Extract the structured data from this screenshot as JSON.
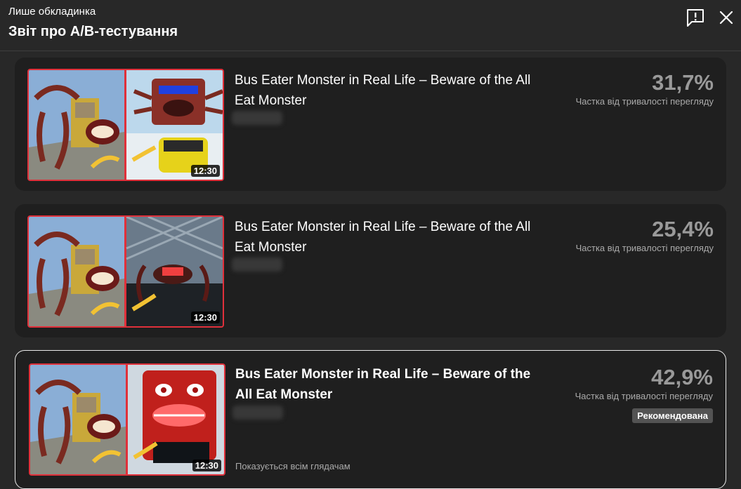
{
  "header": {
    "subtitle": "Лише обкладинка",
    "title": "Звіт про A/B-тестування",
    "feedback_icon": "feedback-icon",
    "close_icon": "close-icon"
  },
  "variants": [
    {
      "title": "Bus Eater Monster in Real Life – Beware of the All Eat Monster",
      "duration": "12:30",
      "percent": "31,7%",
      "metric_label": "Частка від тривалості перегляду"
    },
    {
      "title": "Bus Eater Monster in Real Life – Beware of the All Eat Monster",
      "duration": "12:30",
      "percent": "25,4%",
      "metric_label": "Частка від тривалості перегляду"
    },
    {
      "title": "Bus Eater Monster in Real Life – Beware of the All Eat Monster",
      "duration": "12:30",
      "percent": "42,9%",
      "metric_label": "Частка від тривалості перегляду",
      "badge": "Рекомендована",
      "note": "Показується всім глядачам"
    }
  ],
  "colors": {
    "background": "#282828",
    "card": "#1f1f1f",
    "thumbnail_border": "#e0303a",
    "selected_border": "#e8e8e8"
  }
}
